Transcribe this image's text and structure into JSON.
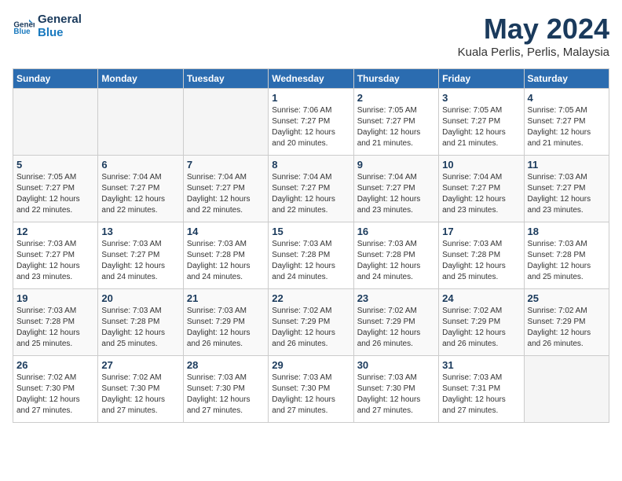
{
  "logo": {
    "line1": "General",
    "line2": "Blue"
  },
  "title": "May 2024",
  "location": "Kuala Perlis, Perlis, Malaysia",
  "days_header": [
    "Sunday",
    "Monday",
    "Tuesday",
    "Wednesday",
    "Thursday",
    "Friday",
    "Saturday"
  ],
  "weeks": [
    [
      {
        "num": "",
        "info": ""
      },
      {
        "num": "",
        "info": ""
      },
      {
        "num": "",
        "info": ""
      },
      {
        "num": "1",
        "info": "Sunrise: 7:06 AM\nSunset: 7:27 PM\nDaylight: 12 hours\nand 20 minutes."
      },
      {
        "num": "2",
        "info": "Sunrise: 7:05 AM\nSunset: 7:27 PM\nDaylight: 12 hours\nand 21 minutes."
      },
      {
        "num": "3",
        "info": "Sunrise: 7:05 AM\nSunset: 7:27 PM\nDaylight: 12 hours\nand 21 minutes."
      },
      {
        "num": "4",
        "info": "Sunrise: 7:05 AM\nSunset: 7:27 PM\nDaylight: 12 hours\nand 21 minutes."
      }
    ],
    [
      {
        "num": "5",
        "info": "Sunrise: 7:05 AM\nSunset: 7:27 PM\nDaylight: 12 hours\nand 22 minutes."
      },
      {
        "num": "6",
        "info": "Sunrise: 7:04 AM\nSunset: 7:27 PM\nDaylight: 12 hours\nand 22 minutes."
      },
      {
        "num": "7",
        "info": "Sunrise: 7:04 AM\nSunset: 7:27 PM\nDaylight: 12 hours\nand 22 minutes."
      },
      {
        "num": "8",
        "info": "Sunrise: 7:04 AM\nSunset: 7:27 PM\nDaylight: 12 hours\nand 22 minutes."
      },
      {
        "num": "9",
        "info": "Sunrise: 7:04 AM\nSunset: 7:27 PM\nDaylight: 12 hours\nand 23 minutes."
      },
      {
        "num": "10",
        "info": "Sunrise: 7:04 AM\nSunset: 7:27 PM\nDaylight: 12 hours\nand 23 minutes."
      },
      {
        "num": "11",
        "info": "Sunrise: 7:03 AM\nSunset: 7:27 PM\nDaylight: 12 hours\nand 23 minutes."
      }
    ],
    [
      {
        "num": "12",
        "info": "Sunrise: 7:03 AM\nSunset: 7:27 PM\nDaylight: 12 hours\nand 23 minutes."
      },
      {
        "num": "13",
        "info": "Sunrise: 7:03 AM\nSunset: 7:27 PM\nDaylight: 12 hours\nand 24 minutes."
      },
      {
        "num": "14",
        "info": "Sunrise: 7:03 AM\nSunset: 7:28 PM\nDaylight: 12 hours\nand 24 minutes."
      },
      {
        "num": "15",
        "info": "Sunrise: 7:03 AM\nSunset: 7:28 PM\nDaylight: 12 hours\nand 24 minutes."
      },
      {
        "num": "16",
        "info": "Sunrise: 7:03 AM\nSunset: 7:28 PM\nDaylight: 12 hours\nand 24 minutes."
      },
      {
        "num": "17",
        "info": "Sunrise: 7:03 AM\nSunset: 7:28 PM\nDaylight: 12 hours\nand 25 minutes."
      },
      {
        "num": "18",
        "info": "Sunrise: 7:03 AM\nSunset: 7:28 PM\nDaylight: 12 hours\nand 25 minutes."
      }
    ],
    [
      {
        "num": "19",
        "info": "Sunrise: 7:03 AM\nSunset: 7:28 PM\nDaylight: 12 hours\nand 25 minutes."
      },
      {
        "num": "20",
        "info": "Sunrise: 7:03 AM\nSunset: 7:28 PM\nDaylight: 12 hours\nand 25 minutes."
      },
      {
        "num": "21",
        "info": "Sunrise: 7:03 AM\nSunset: 7:29 PM\nDaylight: 12 hours\nand 26 minutes."
      },
      {
        "num": "22",
        "info": "Sunrise: 7:02 AM\nSunset: 7:29 PM\nDaylight: 12 hours\nand 26 minutes."
      },
      {
        "num": "23",
        "info": "Sunrise: 7:02 AM\nSunset: 7:29 PM\nDaylight: 12 hours\nand 26 minutes."
      },
      {
        "num": "24",
        "info": "Sunrise: 7:02 AM\nSunset: 7:29 PM\nDaylight: 12 hours\nand 26 minutes."
      },
      {
        "num": "25",
        "info": "Sunrise: 7:02 AM\nSunset: 7:29 PM\nDaylight: 12 hours\nand 26 minutes."
      }
    ],
    [
      {
        "num": "26",
        "info": "Sunrise: 7:02 AM\nSunset: 7:30 PM\nDaylight: 12 hours\nand 27 minutes."
      },
      {
        "num": "27",
        "info": "Sunrise: 7:02 AM\nSunset: 7:30 PM\nDaylight: 12 hours\nand 27 minutes."
      },
      {
        "num": "28",
        "info": "Sunrise: 7:03 AM\nSunset: 7:30 PM\nDaylight: 12 hours\nand 27 minutes."
      },
      {
        "num": "29",
        "info": "Sunrise: 7:03 AM\nSunset: 7:30 PM\nDaylight: 12 hours\nand 27 minutes."
      },
      {
        "num": "30",
        "info": "Sunrise: 7:03 AM\nSunset: 7:30 PM\nDaylight: 12 hours\nand 27 minutes."
      },
      {
        "num": "31",
        "info": "Sunrise: 7:03 AM\nSunset: 7:31 PM\nDaylight: 12 hours\nand 27 minutes."
      },
      {
        "num": "",
        "info": ""
      }
    ]
  ]
}
